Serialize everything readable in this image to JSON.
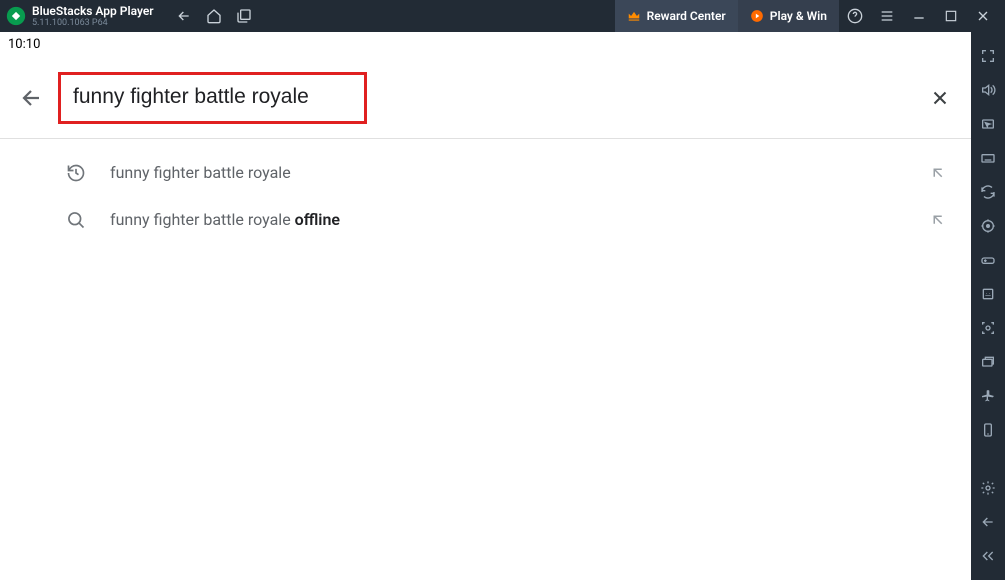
{
  "titlebar": {
    "app_title": "BlueStacks App Player",
    "version": "5.11.100.1063  P64",
    "reward_label": "Reward Center",
    "playwin_label": "Play & Win"
  },
  "statusbar": {
    "time": "10:10"
  },
  "search": {
    "query": "funny fighter battle royale"
  },
  "suggestions": [
    {
      "type": "history",
      "text": "funny fighter battle royale",
      "bold_suffix": ""
    },
    {
      "type": "search",
      "text": "funny fighter battle royale ",
      "bold_suffix": "offline"
    }
  ]
}
